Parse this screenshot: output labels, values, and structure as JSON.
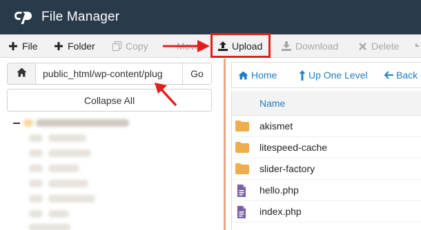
{
  "header": {
    "title": "File Manager",
    "logo": "cpanel-logo"
  },
  "toolbar": {
    "file_label": "File",
    "folder_label": "Folder",
    "copy_label": "Copy",
    "move_label": "Move",
    "upload_label": "Upload",
    "download_label": "Download",
    "delete_label": "Delete"
  },
  "pathbar": {
    "path_value": "public_html/wp-content/plug",
    "go_label": "Go"
  },
  "left": {
    "collapse_label": "Collapse All"
  },
  "nav": {
    "home_label": "Home",
    "up_label": "Up One Level",
    "back_label": "Back"
  },
  "table": {
    "name_header": "Name",
    "rows": [
      {
        "name": "akismet",
        "type": "folder"
      },
      {
        "name": "litespeed-cache",
        "type": "folder"
      },
      {
        "name": "slider-factory",
        "type": "folder"
      },
      {
        "name": "hello.php",
        "type": "php-file"
      },
      {
        "name": "index.php",
        "type": "php-file"
      }
    ]
  },
  "colors": {
    "header_bg": "#293a4a",
    "link_blue": "#1f7ec1",
    "folder": "#f0ad4e",
    "php_file": "#7a5fa6",
    "highlight_red": "#e01e1e",
    "divider": "#f2a37f"
  }
}
